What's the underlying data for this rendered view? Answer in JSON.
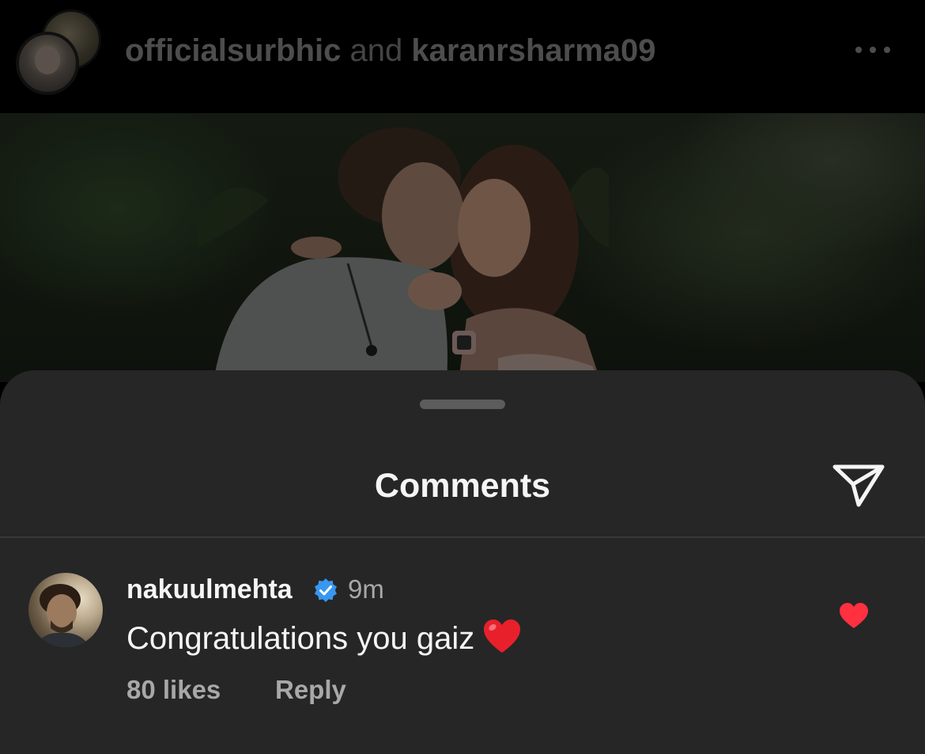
{
  "post_header": {
    "user_one": "officialsurbhic",
    "conjunction": "and",
    "user_two": "karanrsharma09",
    "more_icon": "more-horizontal-icon"
  },
  "comments_sheet": {
    "title": "Comments",
    "share_icon": "paper-plane-icon"
  },
  "comment": {
    "username": "nakuulmehta",
    "verified_icon": "verified-badge-icon",
    "time": "9m",
    "text": "Congratulations you gaiz",
    "emoji_icon": "red-heart-emoji-icon",
    "likes": "80 likes",
    "reply_label": "Reply",
    "liked": true,
    "like_icon": "heart-filled-icon"
  },
  "colors": {
    "sheet_background": "#262626",
    "verified_blue": "#3897f0",
    "like_red": "#ff3040",
    "secondary_text": "#a8a8a8"
  }
}
